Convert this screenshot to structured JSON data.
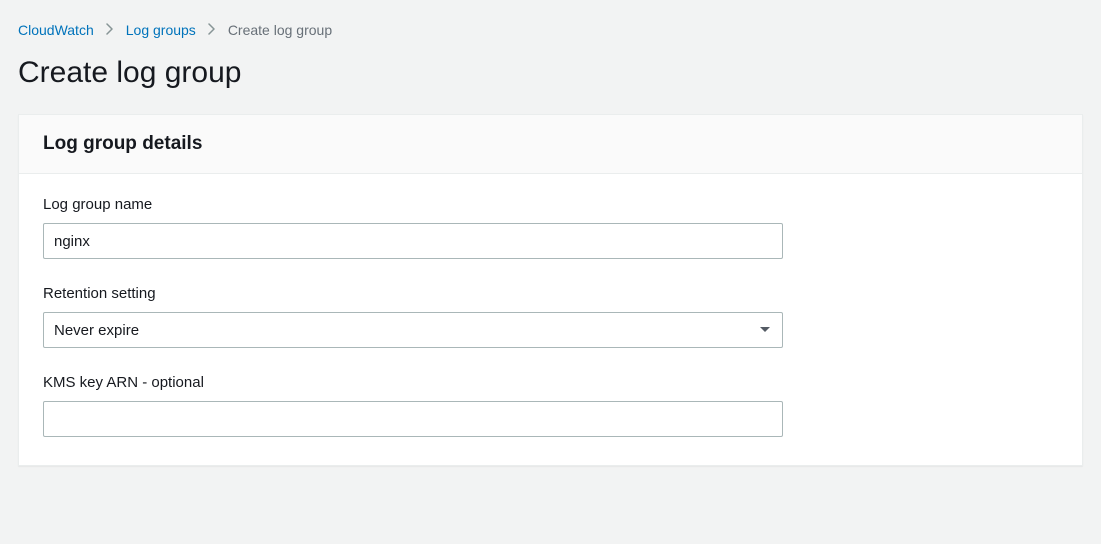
{
  "breadcrumb": {
    "items": [
      {
        "label": "CloudWatch"
      },
      {
        "label": "Log groups"
      }
    ],
    "current": "Create log group"
  },
  "page": {
    "title": "Create log group"
  },
  "panel": {
    "heading": "Log group details"
  },
  "form": {
    "name": {
      "label": "Log group name",
      "value": "nginx"
    },
    "retention": {
      "label": "Retention setting",
      "selected": "Never expire"
    },
    "kms": {
      "label": "KMS key ARN - optional",
      "value": ""
    }
  }
}
